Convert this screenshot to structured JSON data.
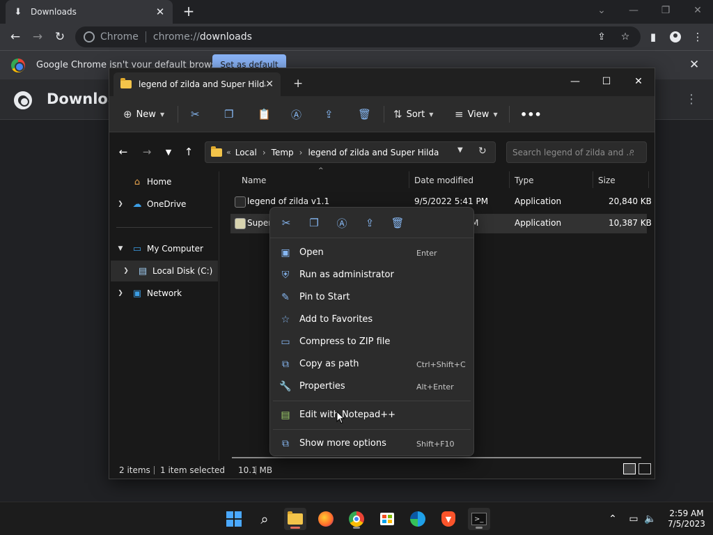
{
  "chrome": {
    "tab_title": "Downloads",
    "site_label": "Chrome",
    "url_prefix": "chrome://",
    "url_main": "downloads",
    "infobar_message": "Google Chrome isn't your default browser",
    "infobar_button": "Set as default",
    "page_title": "Downloads"
  },
  "explorer": {
    "tab_title": "legend of zilda and Super Hilda",
    "commands": {
      "new": "New",
      "sort": "Sort",
      "view": "View"
    },
    "address": {
      "overflow": "«",
      "crumbs": [
        "Local",
        "Temp",
        "legend of zilda and Super Hilda"
      ]
    },
    "search_placeholder": "Search legend of zilda and ...",
    "nav_pane": {
      "home": "Home",
      "onedrive": "OneDrive",
      "my_computer": "My Computer",
      "local_disk": "Local Disk (C:)",
      "network": "Network"
    },
    "columns": {
      "name": "Name",
      "date": "Date modified",
      "type": "Type",
      "size": "Size"
    },
    "files": [
      {
        "name": "legend of zilda v1.1",
        "date": "9/5/2022 5:41 PM",
        "type": "Application",
        "size": "20,840 KB"
      },
      {
        "name": "Superh",
        "date": "M",
        "type": "Application",
        "size": "10,387 KB"
      }
    ],
    "status": {
      "items": "2 items",
      "selected": "1 item selected",
      "size": "10.1 MB"
    }
  },
  "context_menu": {
    "items": [
      {
        "label": "Open",
        "shortcut": "Enter"
      },
      {
        "label": "Run as administrator",
        "shortcut": ""
      },
      {
        "label": "Pin to Start",
        "shortcut": ""
      },
      {
        "label": "Add to Favorites",
        "shortcut": ""
      },
      {
        "label": "Compress to ZIP file",
        "shortcut": ""
      },
      {
        "label": "Copy as path",
        "shortcut": "Ctrl+Shift+C"
      },
      {
        "label": "Properties",
        "shortcut": "Alt+Enter"
      },
      {
        "label": "Edit with Notepad++",
        "shortcut": ""
      },
      {
        "label": "Show more options",
        "shortcut": "Shift+F10"
      }
    ]
  },
  "taskbar": {
    "time": "2:59 AM",
    "date": "7/5/2023"
  },
  "colors": {
    "accent_blue": "#86b7f2",
    "chrome_dark": "#202124",
    "explorer_bg": "#191919"
  }
}
